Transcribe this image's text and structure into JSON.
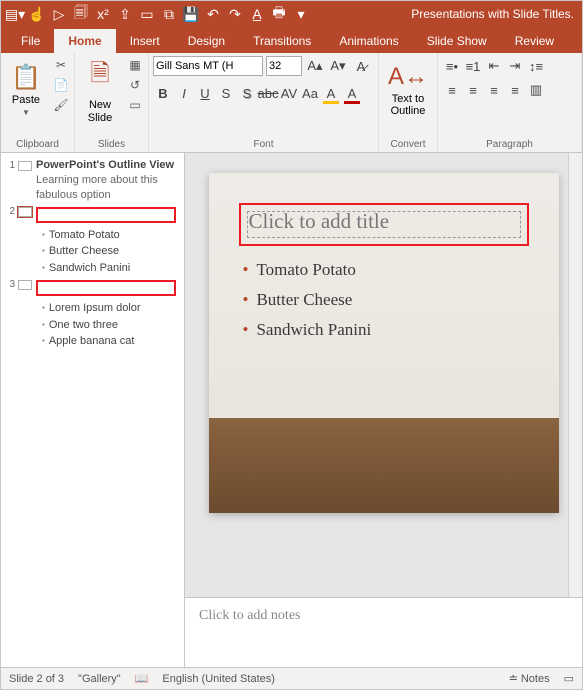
{
  "app": {
    "title": "Presentations with Slide Titles."
  },
  "tabs": {
    "file": "File",
    "home": "Home",
    "insert": "Insert",
    "design": "Design",
    "transitions": "Transitions",
    "animations": "Animations",
    "slideshow": "Slide Show",
    "review": "Review",
    "active": "home"
  },
  "ribbon": {
    "clipboard": {
      "paste": "Paste",
      "label": "Clipboard"
    },
    "slides": {
      "newslide": "New\nSlide",
      "label": "Slides"
    },
    "font": {
      "name": "Gill Sans MT (H",
      "size": "32",
      "label": "Font"
    },
    "convert": {
      "text_to_outline": "Text to\nOutline",
      "label": "Convert"
    },
    "paragraph": {
      "label": "Paragraph"
    }
  },
  "outline": {
    "slides": [
      {
        "num": "1",
        "title": "PowerPoint's Outline View",
        "subtitle": "Learning more about this fabulous option",
        "bullets": []
      },
      {
        "num": "2",
        "title": "",
        "subtitle": "",
        "bullets": [
          "Tomato Potato",
          "Butter Cheese",
          "Sandwich Panini"
        ]
      },
      {
        "num": "3",
        "title": "",
        "subtitle": "",
        "bullets": [
          "Lorem Ipsum dolor",
          "One two three",
          "Apple banana cat"
        ]
      }
    ]
  },
  "slide": {
    "title_placeholder": "Click to add title",
    "bullets": [
      "Tomato Potato",
      "Butter Cheese",
      "Sandwich Panini"
    ]
  },
  "notes": {
    "placeholder": "Click to add notes"
  },
  "status": {
    "slide_indicator": "Slide 2 of 3",
    "layout_name": "\"Gallery\"",
    "language": "English (United States)",
    "notes_btn": "Notes"
  }
}
